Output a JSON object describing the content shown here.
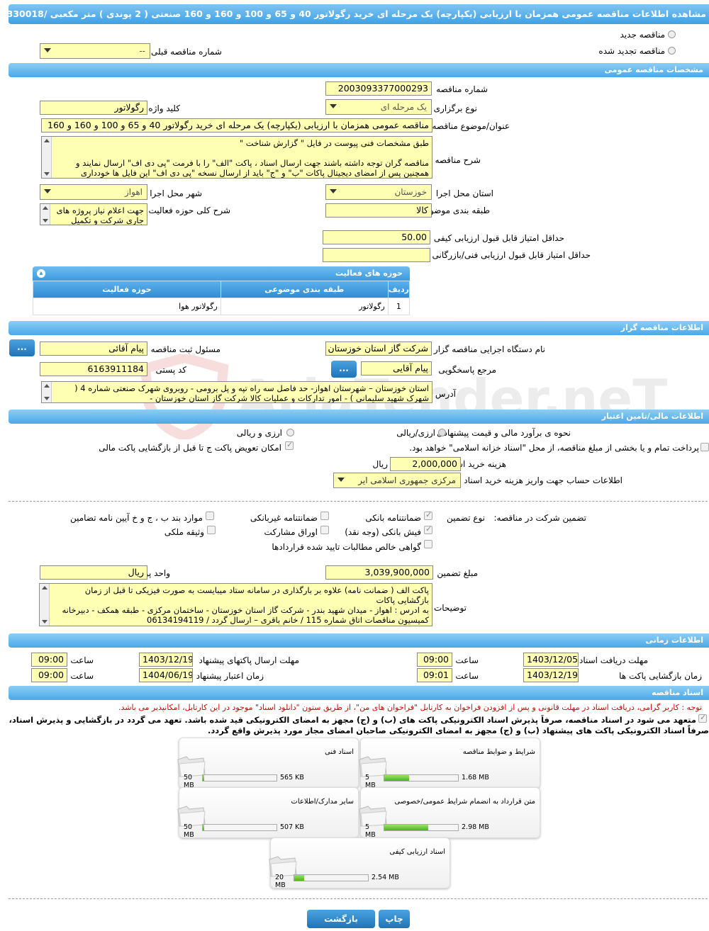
{
  "title": "مشاهده اطلاعات مناقصه عمومی همزمان با ارزیابی (یکپارچه) یک مرحله ای خرید رگولاتور 40 و 65 و 100 و 160 و 160 صنعتی ( 2 پوندی ) متر مکعبی /0330018 ( مرتبه اول )",
  "top": {
    "new_tender": "مناقصه جدید",
    "renewed_tender": "مناقصه تجدید شده",
    "prev_tender_label": "شماره مناقصه قبلی",
    "prev_tender_value": "--"
  },
  "general": {
    "header": "مشخصات مناقصه عمومی",
    "number_label": "شماره مناقصه",
    "number_value": "2003093377000293",
    "type_label": "نوع برگزاری",
    "type_value": "یک مرحله ای",
    "keyword_label": "کلید واژه",
    "keyword_value": "رگولاتور",
    "subject_label": "عنوان/موضوع مناقصه",
    "subject_value": "مناقصه عمومی همزمان با ارزیابی (یکپارچه) یک مرحله ای خرید رگولاتور 40 و 65 و 100 و 160 و 160",
    "desc_label": "شرح مناقصه",
    "desc_lines": [
      "طبق مشخصات فنی پیوست در فایل  \" گزارش شناخت \"",
      "",
      "مناقصه گران توجه داشته باشند جهت ارسال اسناد ، پاکت \"الف\" را با فرمت  \"پی دی اف\"  ارسال نمایند و",
      "همچنین پس از امضای دیجیتال پاکات  \"ب\" و \"ج\" باید از ارسال نسخه \"پی دی اف\"  این فایل ها خودداری"
    ],
    "province_label": "استان محل اجرا",
    "province_value": "خوزستان",
    "city_label": "شهر محل اجرا",
    "city_value": "اهواز",
    "category_label": "طبقه بندی موضوعی",
    "category_value": "کالا",
    "activity_desc_label": "شرح کلی حوزه فعالیت",
    "activity_desc_lines": [
      "جهت اعلام نیاز پروژه های",
      "جاری شرکت و تکمیل"
    ],
    "min_quality_label": "حداقل امتیاز قابل قبول ارزیابی کیفی",
    "min_quality_value": "50.00",
    "min_tech_label": "حداقل امتیاز قابل قبول ارزیابی فنی/بازرگانی",
    "min_tech_value": ""
  },
  "activity_table": {
    "header": "حوزه های فعالیت",
    "columns": [
      "ردیف",
      "طبقه بندی موضوعی",
      "حوزه فعالیت"
    ],
    "rows": [
      [
        "1",
        "رگولاتور",
        "رگولاتور هوا"
      ]
    ]
  },
  "organizer": {
    "header": "اطلاعات مناقصه گزار",
    "org_label": "نام دستگاه اجرایی مناقصه گزار",
    "org_value": "شرکت گاز استان خوزستان",
    "responsible_label": "مسئول ثبت مناقصه",
    "responsible_value": "پیام  آقائی",
    "ref_label": "مرجع پاسخگویی",
    "ref_value": "پیام آقایی",
    "postal_label": "کد پستی",
    "postal_value": "6163911184",
    "address_label": "آدرس",
    "address_lines": [
      "استان خوزستان – شهرستان اهواز- حد فاصل سه راه تپه  و پل برومی - روبروی شهرک صنعتی شماره 4 (",
      "شهرک شهید سلیمانی  ) - امور تدارکات و عملیات کالا شرکت گاز استان خوزستان -"
    ],
    "dots": "..."
  },
  "finance": {
    "header": "اطلاعات مالی/تامین اعتبار",
    "estimate_label": "نحوه ی برآورد مالی و قیمت پیشنهادی",
    "opt_rial": "ارزی/ریالی",
    "opt_fx": "ارزی و ریالی",
    "treasury_text": "پرداخت تمام و یا بخشی از مبلغ مناقصه، از محل \"اسناد خزانه اسلامی\" خواهد بود.",
    "swap_text": "امکان تعویض پاکت ج تا قبل از بازگشایی پاکت مالی",
    "purchase_fee_label": "هزینه خرید اسناد",
    "purchase_fee_value": "2,000,000",
    "purchase_fee_unit": "ریال",
    "account_label": "اطلاعات حساب جهت واریز هزینه خرید اسناد",
    "account_value": "مرکزی جمهوری اسلامی ایر"
  },
  "guarantee": {
    "label": "تضمین شرکت در مناقصه:",
    "type_label": "نوع تضمین",
    "options": {
      "bank": "ضمانتنامه بانکی",
      "nonbank": "ضمانتنامه غیربانکی",
      "items": "موارد بند ب ، ج و خ آیین نامه تضامین",
      "cash": "فیش بانکی (وجه نقد)",
      "bonds": "اوراق مشارکت",
      "property": "وثیقه ملکی",
      "receivables": "گواهی خالص مطالبات تایید شده قراردادها"
    },
    "amount_label": "مبلغ تضمین",
    "amount_value": "3,039,900,000",
    "currency_label": "واحد پول",
    "currency_value": "ریال",
    "notes_label": "توضیحات",
    "notes_lines": [
      "پاکت الف ( ضمانت نامه) علاوه بر بارگذاری در سامانه ستاد میبایست به صورت فیزیکی تا قبل از زمان",
      "بازگشایی پاکات",
      "به ادرس : اهواز - میدان شهید بندر - شرکت گاز استان خوزستان - ساختمان مرکزی - طبقه همکف - دبیرخانه",
      "کمیسیون مناقصات  اتاق شماره 115 / خانم باقری – ارسال گردد / 06134194119"
    ]
  },
  "timing": {
    "header": "اطلاعات زمانی",
    "receive_label": "مهلت دریافت اسناد",
    "receive_date": "1403/12/05",
    "receive_time": "09:00",
    "send_label": "مهلت ارسال پاکتهای پیشنهاد",
    "send_date": "1403/12/19",
    "send_time": "09:00",
    "open_label": "زمان بازگشایی پاکت ها",
    "open_date": "1403/12/19",
    "open_time": "09:01",
    "valid_label": "زمان اعتبار پیشنهاد",
    "valid_date": "1404/06/19",
    "valid_time": "09:00",
    "time_label": "ساعت"
  },
  "docs": {
    "header": "اسناد مناقصه",
    "note_red": "توجه : کاربر گرامی، دریافت اسناد در مهلت قانونی و پس از افزودن فراخوان به کارتابل \"فراخوان های من\"، از طریق ستون \"دانلود اسناد\" موجود در این کارتابل، امکانپذیر می باشد.",
    "commit_line1": "متعهد می شود در اسناد مناقصه، صرفاً پذیرش اسناد الکترونیکی پاکت های (ب) و (ج) مجهز به امضای الکترونیکی قید شده باشد. تعهد می گردد در بازگشایی و پذیرش اسناد،",
    "commit_line2": "صرفاً اسناد الکترونیکی پاکت های پیشنهاد (ب) و (ج) مجهز به امضای الکترونیکی صاحبان امضای مجاز مورد پذیرش واقع گردد.",
    "files": [
      {
        "name": "شرایط و ضوابط مناقصه",
        "size": "1.68 MB",
        "max": "5 MB",
        "fill": 0.34
      },
      {
        "name": "اسناد فنی",
        "size": "565 KB",
        "max": "50 MB",
        "fill": 0.01
      },
      {
        "name": "متن قرارداد به انضمام شرایط عمومی/خصوصی",
        "size": "2.98 MB",
        "max": "5 MB",
        "fill": 0.6
      },
      {
        "name": "سایر مدارک/اطلاعات",
        "size": "507 KB",
        "max": "50 MB",
        "fill": 0.01
      },
      {
        "name": "اسناد ارزیابی کیفی",
        "size": "2.54 MB",
        "max": "20 MB",
        "fill": 0.13
      }
    ]
  },
  "footer": {
    "print": "چاپ",
    "back": "بازگشت"
  },
  "watermark": "AriaTender.neT",
  "colors": {
    "header_blue": "#3fa1e6",
    "field_yellow": "#ffffb3",
    "progress_green": "#4fb41d",
    "note_red": "#d00000"
  }
}
